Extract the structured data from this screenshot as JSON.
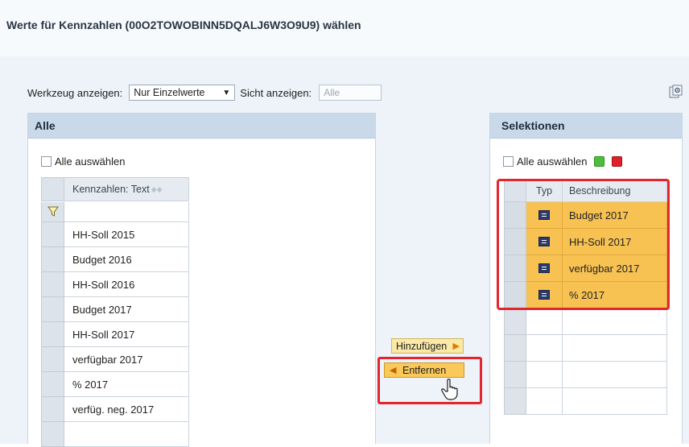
{
  "dialog": {
    "title": "Werte für Kennzahlen (00O2TOWOBINN5DQALJ6W3O9U9) wählen"
  },
  "toolbar": {
    "werkzeug_label": "Werkzeug anzeigen:",
    "werkzeug_value": "Nur Einzelwerte",
    "sicht_label": "Sicht anzeigen:",
    "sicht_placeholder": "Alle",
    "settings_icon": "settings-icon"
  },
  "left_panel": {
    "header": "Alle",
    "select_all_label": "Alle auswählen",
    "column_header": "Kennzahlen: Text",
    "filter_icon": "filter-icon",
    "rows": [
      "HH-Soll 2015",
      "Budget 2016",
      "HH-Soll 2016",
      "Budget 2017",
      "HH-Soll 2017",
      "verfügbar 2017",
      "% 2017",
      "verfüg. neg. 2017",
      ""
    ]
  },
  "buttons": {
    "add_label": "Hinzufügen",
    "remove_label": "Entfernen",
    "accent_color": "#fac95a",
    "highlight_color": "#e3252e"
  },
  "right_panel": {
    "header": "Selektionen",
    "select_all_label": "Alle auswählen",
    "col_type": "Typ",
    "col_desc": "Beschreibung",
    "rows": [
      {
        "type_icon": "equals-icon",
        "desc": "Budget 2017",
        "selected": true
      },
      {
        "type_icon": "equals-icon",
        "desc": "HH-Soll 2017",
        "selected": true
      },
      {
        "type_icon": "equals-icon",
        "desc": "verfügbar 2017",
        "selected": true
      },
      {
        "type_icon": "equals-icon",
        "desc": "% 2017",
        "selected": true
      },
      {
        "type_icon": "",
        "desc": "",
        "selected": false
      },
      {
        "type_icon": "",
        "desc": "",
        "selected": false
      },
      {
        "type_icon": "",
        "desc": "",
        "selected": false
      },
      {
        "type_icon": "",
        "desc": "",
        "selected": false
      }
    ]
  }
}
